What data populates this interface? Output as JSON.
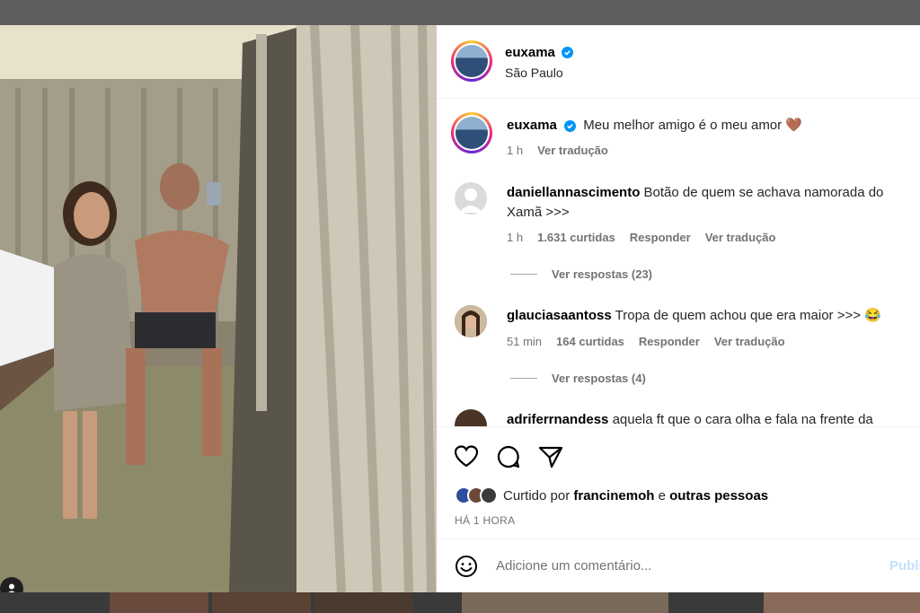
{
  "post": {
    "author": "euxama",
    "location": "São Paulo",
    "caption": "Meu melhor amigo é o meu amor 🤎",
    "caption_time": "1 h",
    "caption_translate": "Ver tradução"
  },
  "comments": [
    {
      "user": "daniellannascimento",
      "text": "Botão de quem se achava namorada do Xamã >>>",
      "time": "1 h",
      "likes": "1.631 curtidas",
      "reply": "Responder",
      "translate": "Ver tradução",
      "view_replies": "Ver respostas (23)"
    },
    {
      "user": "glauciasaantoss",
      "text": "Tropa de quem achou que era maior >>> 😂",
      "time": "51 min",
      "likes": "164 curtidas",
      "reply": "Responder",
      "translate": "Ver tradução",
      "view_replies": "Ver respostas (4)"
    },
    {
      "user": "adriferrnandess",
      "text": "aquela ft que o cara olha e fala na frente da"
    }
  ],
  "actions": {
    "icons": [
      "heart-icon",
      "comment-icon",
      "share-icon"
    ],
    "liked_by_prefix": "Curtido por",
    "liked_by_user": "francinemoh",
    "liked_by_joiner": "e",
    "liked_by_others": "outras pessoas",
    "time_ago": "HÁ 1 HORA",
    "comment_placeholder": "Adicione um comentário...",
    "publish": "Publi"
  },
  "colors": {
    "verified": "#0095f6",
    "muted": "#737373",
    "publish_disabled": "#c3e1fd"
  }
}
